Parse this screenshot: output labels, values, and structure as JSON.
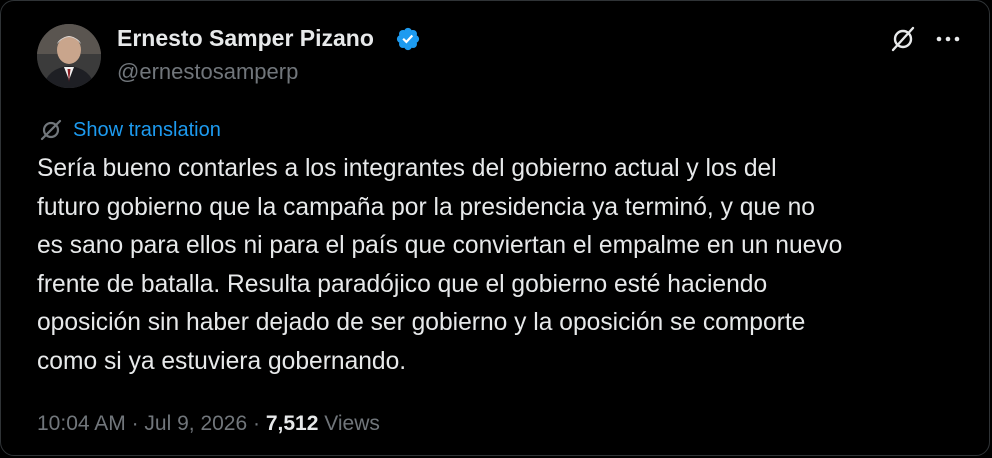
{
  "author": {
    "display_name": "Ernesto Samper Pizano",
    "handle": "@ernestosamperp",
    "verified": true,
    "verified_color": "#1d9bf0"
  },
  "actions": {
    "grok_icon": "grok-slash-icon",
    "more_icon": "more-horizontal-icon"
  },
  "translation": {
    "label": "Show translation",
    "link_color": "#1d9bf0"
  },
  "tweet": {
    "lines": [
      "Sería bueno contarles a los integrantes del gobierno actual y los del",
      "futuro gobierno que la campaña por la presidencia ya terminó, y que no",
      "es sano para ellos ni para el país que conviertan el empalme en un nuevo",
      "frente de batalla. Resulta paradójico que el gobierno esté haciendo",
      "oposición sin haber dejado de ser gobierno y la oposición se comporte",
      "como si ya estuviera gobernando."
    ]
  },
  "meta": {
    "time": "10:04 AM",
    "separator": "·",
    "date": "Jul 9, 2026",
    "views_count": "7,512",
    "views_label": "Views"
  },
  "colors": {
    "background": "#000000",
    "text": "#e7e9ea",
    "secondary": "#71767b",
    "border": "#2f3336"
  }
}
